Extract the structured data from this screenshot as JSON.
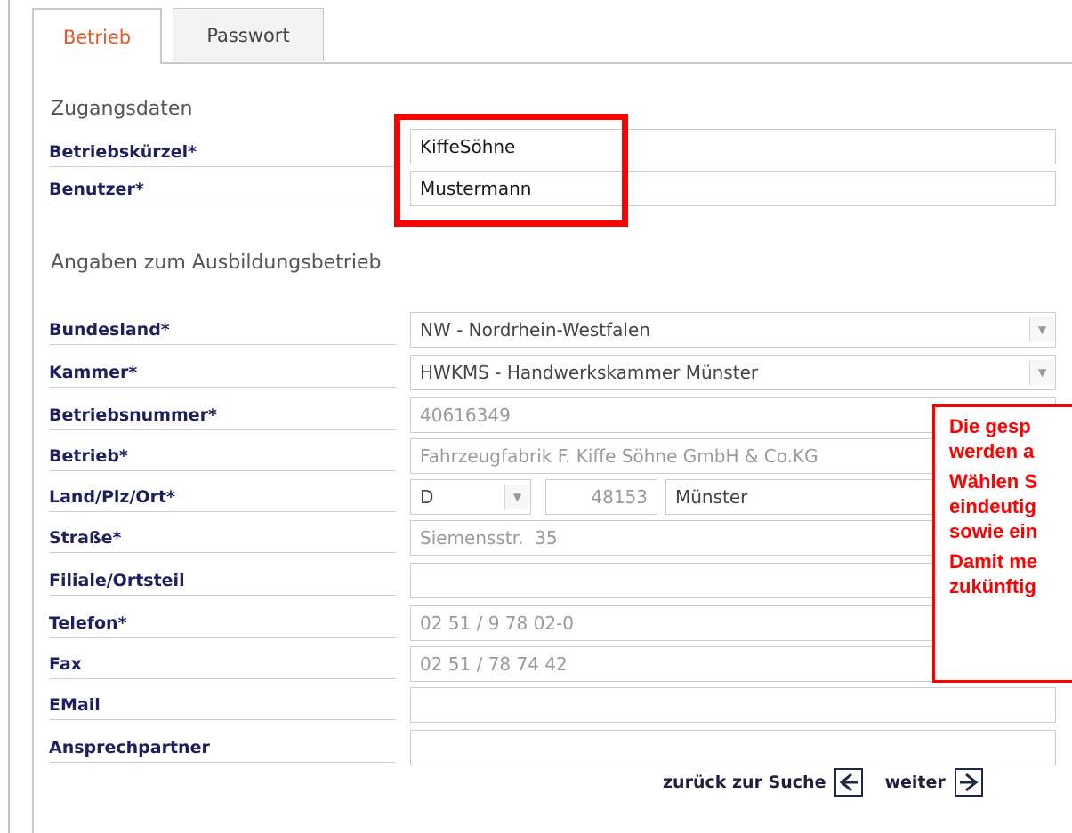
{
  "tabs": [
    {
      "label": "Betrieb",
      "active": true
    },
    {
      "label": "Passwort",
      "active": false
    }
  ],
  "sections": {
    "access": "Zugangsdaten",
    "company": "Angaben zum Ausbildungsbetrieb"
  },
  "access_fields": [
    {
      "label": "Betriebskürzel*",
      "value": "KiffeSöhne"
    },
    {
      "label": "Benutzer*",
      "value": "Mustermann"
    }
  ],
  "company_fields": {
    "bundesland": {
      "label": "Bundesland*",
      "value": "NW - Nordrhein-Westfalen"
    },
    "kammer": {
      "label": "Kammer*",
      "value": "HWKMS - Handwerkskammer Münster"
    },
    "betriebsnummer": {
      "label": "Betriebsnummer*",
      "value": "40616349"
    },
    "betrieb": {
      "label": "Betrieb*",
      "value": "Fahrzeugfabrik F. Kiffe Söhne GmbH & Co.KG"
    },
    "land_plz_ort": {
      "label": "Land/Plz/Ort*",
      "land": "D",
      "plz": "48153",
      "ort": "Münster"
    },
    "strasse": {
      "label": "Straße*",
      "value": "Siemensstr.  35"
    },
    "filiale": {
      "label": "Filiale/Ortsteil",
      "value": ""
    },
    "telefon": {
      "label": "Telefon*",
      "value": "02 51 / 9 78 02-0"
    },
    "fax": {
      "label": "Fax",
      "value": "02 51 / 78 74 42"
    },
    "email": {
      "label": "EMail",
      "value": ""
    },
    "ansprechpartner": {
      "label": "Ansprechpartner",
      "value": ""
    }
  },
  "callout": {
    "line1": "Die gesp",
    "line2": "werden a",
    "line3": "Wählen S",
    "line4": "eindeutig",
    "line5": "sowie ein",
    "line6": "Damit me",
    "line7": "zukünftig"
  },
  "footer": {
    "back_label": "zurück zur Suche",
    "next_label": "weiter"
  },
  "colors": {
    "active_tab": "#e05a2b",
    "label": "#1f1f5f",
    "annotation": "#ff0000"
  }
}
